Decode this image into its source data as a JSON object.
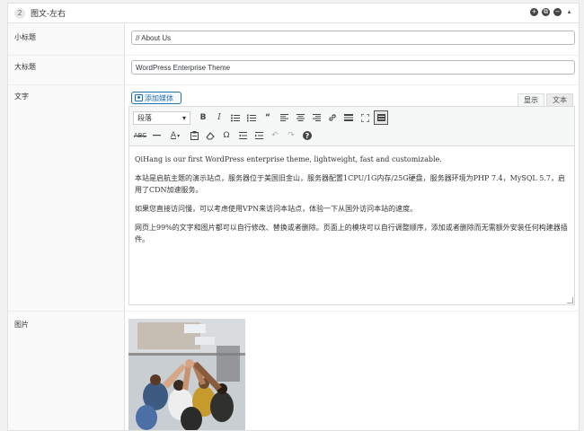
{
  "row": {
    "number": "2",
    "title": "图文-左右",
    "controls": [
      "+",
      "⧉",
      "−",
      "▴"
    ]
  },
  "fields": {
    "subtitle": {
      "label": "小标题",
      "value": "// About Us"
    },
    "title": {
      "label": "大标题",
      "value": "WordPress Enterprise Theme"
    },
    "text": {
      "label": "文字"
    },
    "image": {
      "label": "图片"
    }
  },
  "editor": {
    "add_media_label": "添加媒体",
    "tabs": {
      "visual": "显示",
      "text": "文本"
    },
    "format_select": "段落",
    "toolbar_row1": [
      "bold-icon",
      "italic-icon",
      "bullet-list-icon",
      "numbered-list-icon",
      "blockquote-icon",
      "align-left-icon",
      "align-center-icon",
      "align-right-icon",
      "link-icon",
      "read-more-icon",
      "fullscreen-icon",
      "toolbar-toggle-icon"
    ],
    "toolbar_row2": [
      "strikethrough-icon",
      "horizontal-line-icon",
      "text-color-icon",
      "paste-text-icon",
      "clear-formatting-icon",
      "special-char-icon",
      "outdent-icon",
      "indent-icon",
      "undo-icon",
      "redo-icon",
      "help-icon"
    ],
    "paragraphs": [
      "QiHang is our first WordPress enterprise theme, lightweight, fast and customizable.",
      "本站是启航主题的演示站点，服务器位于美国旧金山，服务器配置1CPU/1G内存/25G硬盘，服务器环境为PHP 7.4，MySQL 5.7，启用了CDN加速服务。",
      "如果您直接访问慢，可以考虑使用VPN来访问本站点，体验一下从国外访问本站的速度。",
      "网页上99%的文字和图片都可以自行修改、替换或者删除。页面上的模块可以自行调整顺序，添加或者删除而无需额外安装任何构建器插件。"
    ]
  },
  "colors": {
    "accent": "#2271b1",
    "border": "#dcdcde",
    "label_bg": "#f9f9f9"
  }
}
